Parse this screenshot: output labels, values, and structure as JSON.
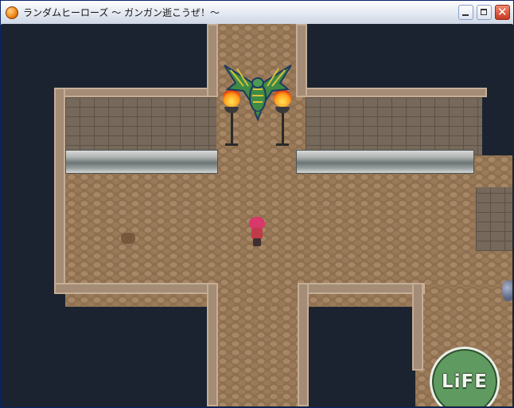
{
  "window": {
    "title": "ランダムヒーローズ 〜 ガンガン逝こうぜ！〜",
    "controls": {
      "minimize_icon": "minimize-icon",
      "maximize_icon": "maximize-icon",
      "close_icon": "close-icon"
    }
  },
  "hud": {
    "life_label": "LiFE"
  },
  "scene": {
    "colors": {
      "void": "#1b2330",
      "floor": "#8e7050",
      "wall": "#76685a",
      "life_button": "#5f9a60"
    },
    "sprites": [
      "winged-monster-icon",
      "hero-sprite",
      "torch-icon",
      "urn-icon"
    ]
  }
}
